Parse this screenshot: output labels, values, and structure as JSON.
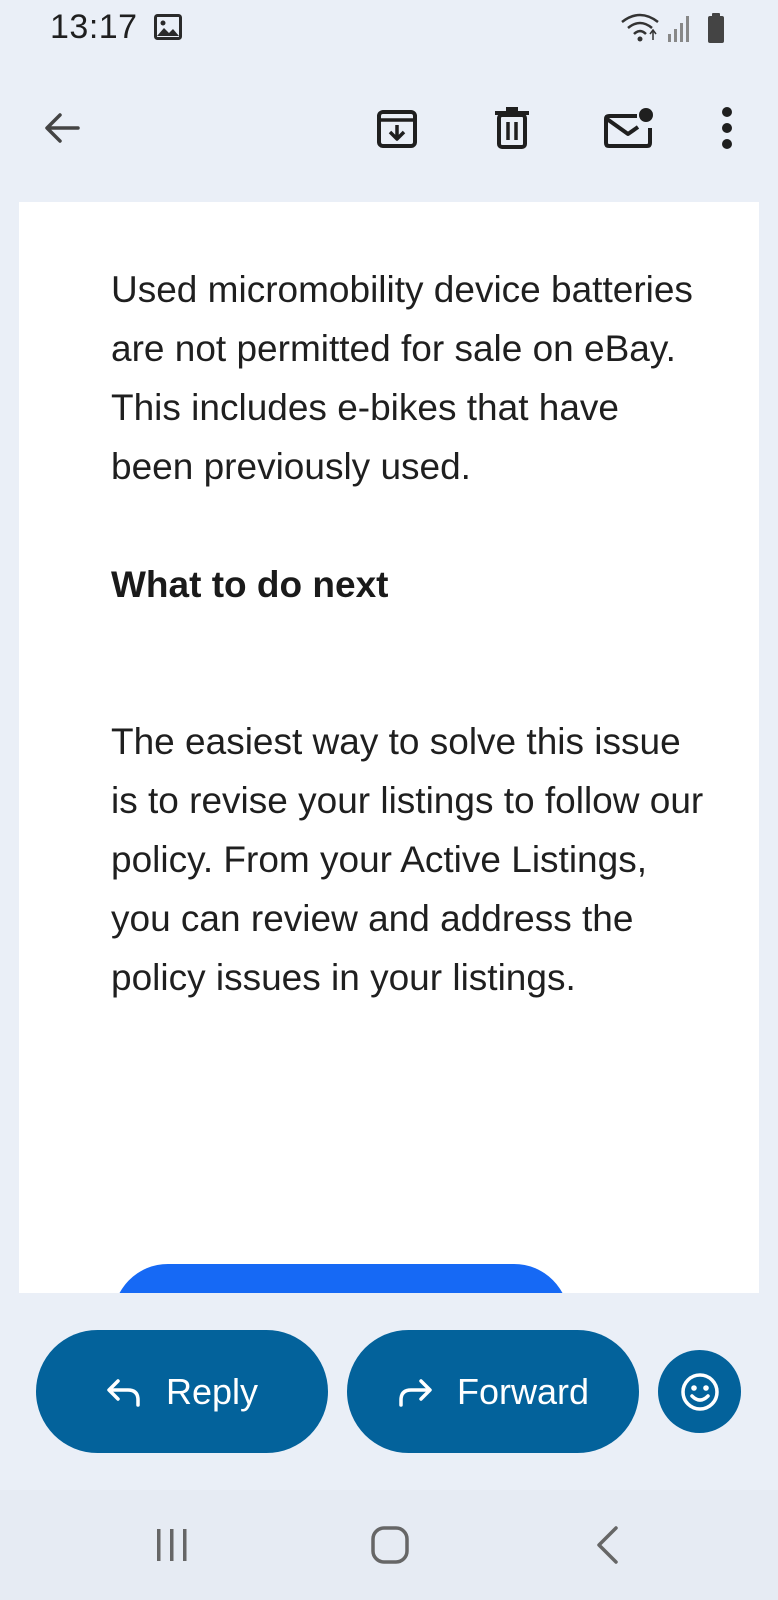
{
  "status_bar": {
    "time": "13:17",
    "icons": [
      "gallery-icon",
      "wifi-icon",
      "signal-icon",
      "battery-icon"
    ]
  },
  "toolbar": {
    "icons": [
      "back-arrow-icon",
      "archive-icon",
      "delete-icon",
      "mark-unread-icon",
      "more-options-icon"
    ]
  },
  "email": {
    "paragraph_1": "Used micromobility device batteries are not permitted for sale on eBay. This includes e-bikes that have been previously used.",
    "heading": "What to do next",
    "paragraph_2": "The easiest way to solve this issue is to revise your listings to follow our policy. From your Active Listings, you can review and address the policy issues in your listings.",
    "cta_color": "#1669f5"
  },
  "actions": {
    "reply_label": "Reply",
    "forward_label": "Forward",
    "emoji_icon": "emoji-reaction-icon",
    "button_color": "#03629b"
  },
  "nav_bar": {
    "icons": [
      "recent-apps-icon",
      "home-icon",
      "back-icon"
    ]
  }
}
